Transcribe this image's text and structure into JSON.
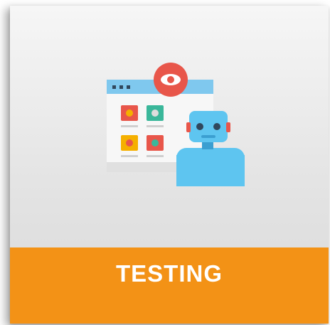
{
  "tile": {
    "label": "TESTING",
    "icon": "robot-testing-icon"
  },
  "colors": {
    "banner": "#f39216",
    "label_text": "#ffffff",
    "robot": "#5ec5f0",
    "eye_badge": "#e8564a",
    "window_header": "#7fc8ee"
  }
}
